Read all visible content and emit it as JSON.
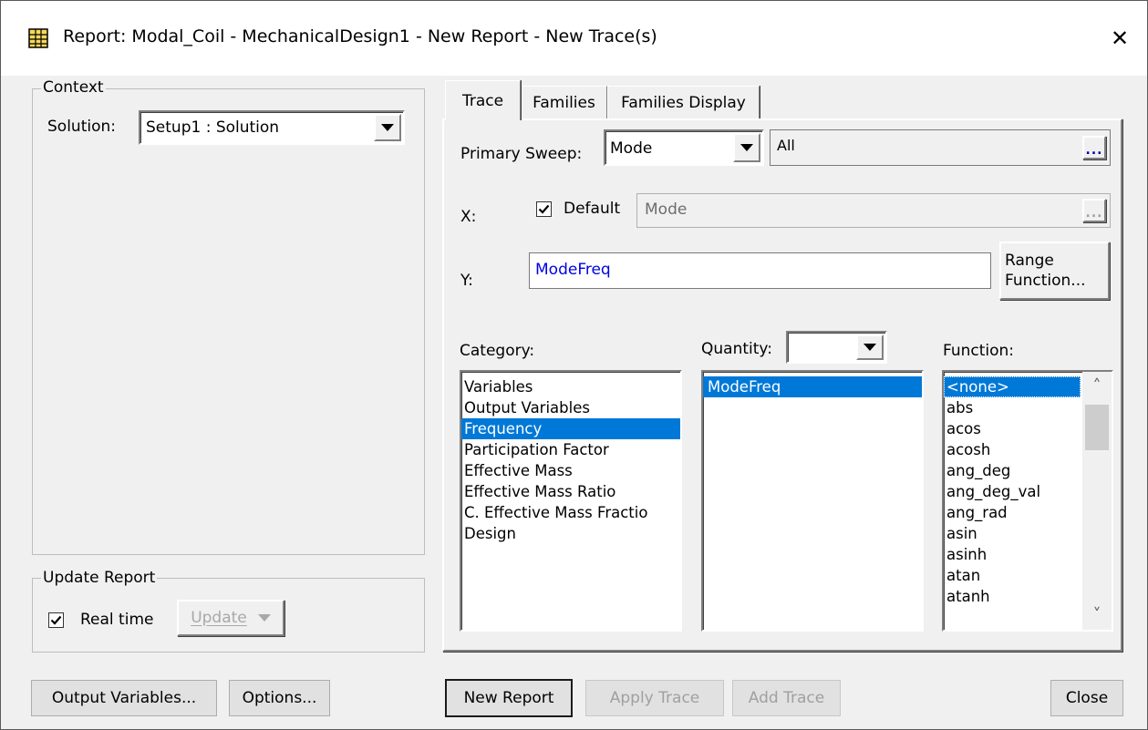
{
  "window": {
    "title": "Report: Modal_Coil - MechanicalDesign1 - New Report - New Trace(s)",
    "close_glyph": "✕"
  },
  "context": {
    "group_label": "Context",
    "solution_label": "Solution:",
    "solution_value": "Setup1 : Solution"
  },
  "update_report": {
    "group_label": "Update Report",
    "realtime_label": "Real time",
    "realtime_checked": true,
    "update_label": "Update"
  },
  "tabs": [
    {
      "label": "Trace",
      "active": true
    },
    {
      "label": "Families",
      "active": false
    },
    {
      "label": "Families Display",
      "active": false
    }
  ],
  "trace": {
    "primary_sweep_label": "Primary Sweep:",
    "primary_sweep_value": "Mode",
    "primary_sweep_range": "All",
    "ellipsis": "...",
    "x_label": "X:",
    "x_default_label": "Default",
    "x_default_checked": true,
    "x_value": "Mode",
    "y_label": "Y:",
    "y_value": "ModeFreq",
    "range_function_line1": "Range",
    "range_function_line2": "Function...",
    "category_label": "Category:",
    "quantity_label": "Quantity:",
    "quantity_value": "",
    "function_label": "Function:",
    "categories": [
      "Variables",
      "Output Variables",
      "Frequency",
      "Participation Factor",
      "Effective Mass",
      "Effective Mass Ratio",
      "C. Effective Mass Fractio",
      "Design"
    ],
    "selected_category": "Frequency",
    "quantities": [
      "ModeFreq"
    ],
    "selected_quantity": "ModeFreq",
    "functions": [
      "<none>",
      "abs",
      "acos",
      "acosh",
      "ang_deg",
      "ang_deg_val",
      "ang_rad",
      "asin",
      "asinh",
      "atan",
      "atanh"
    ],
    "selected_function": "<none>",
    "scroll_up": "˄",
    "scroll_down": "˅"
  },
  "buttons": {
    "output_variables": "Output Variables...",
    "options": "Options...",
    "new_report": "New Report",
    "apply_trace": "Apply Trace",
    "add_trace": "Add Trace",
    "close": "Close"
  },
  "colors": {
    "selection": "#0078d7",
    "link_blue": "#0000e6",
    "dialog_bg": "#f0f0f0"
  }
}
